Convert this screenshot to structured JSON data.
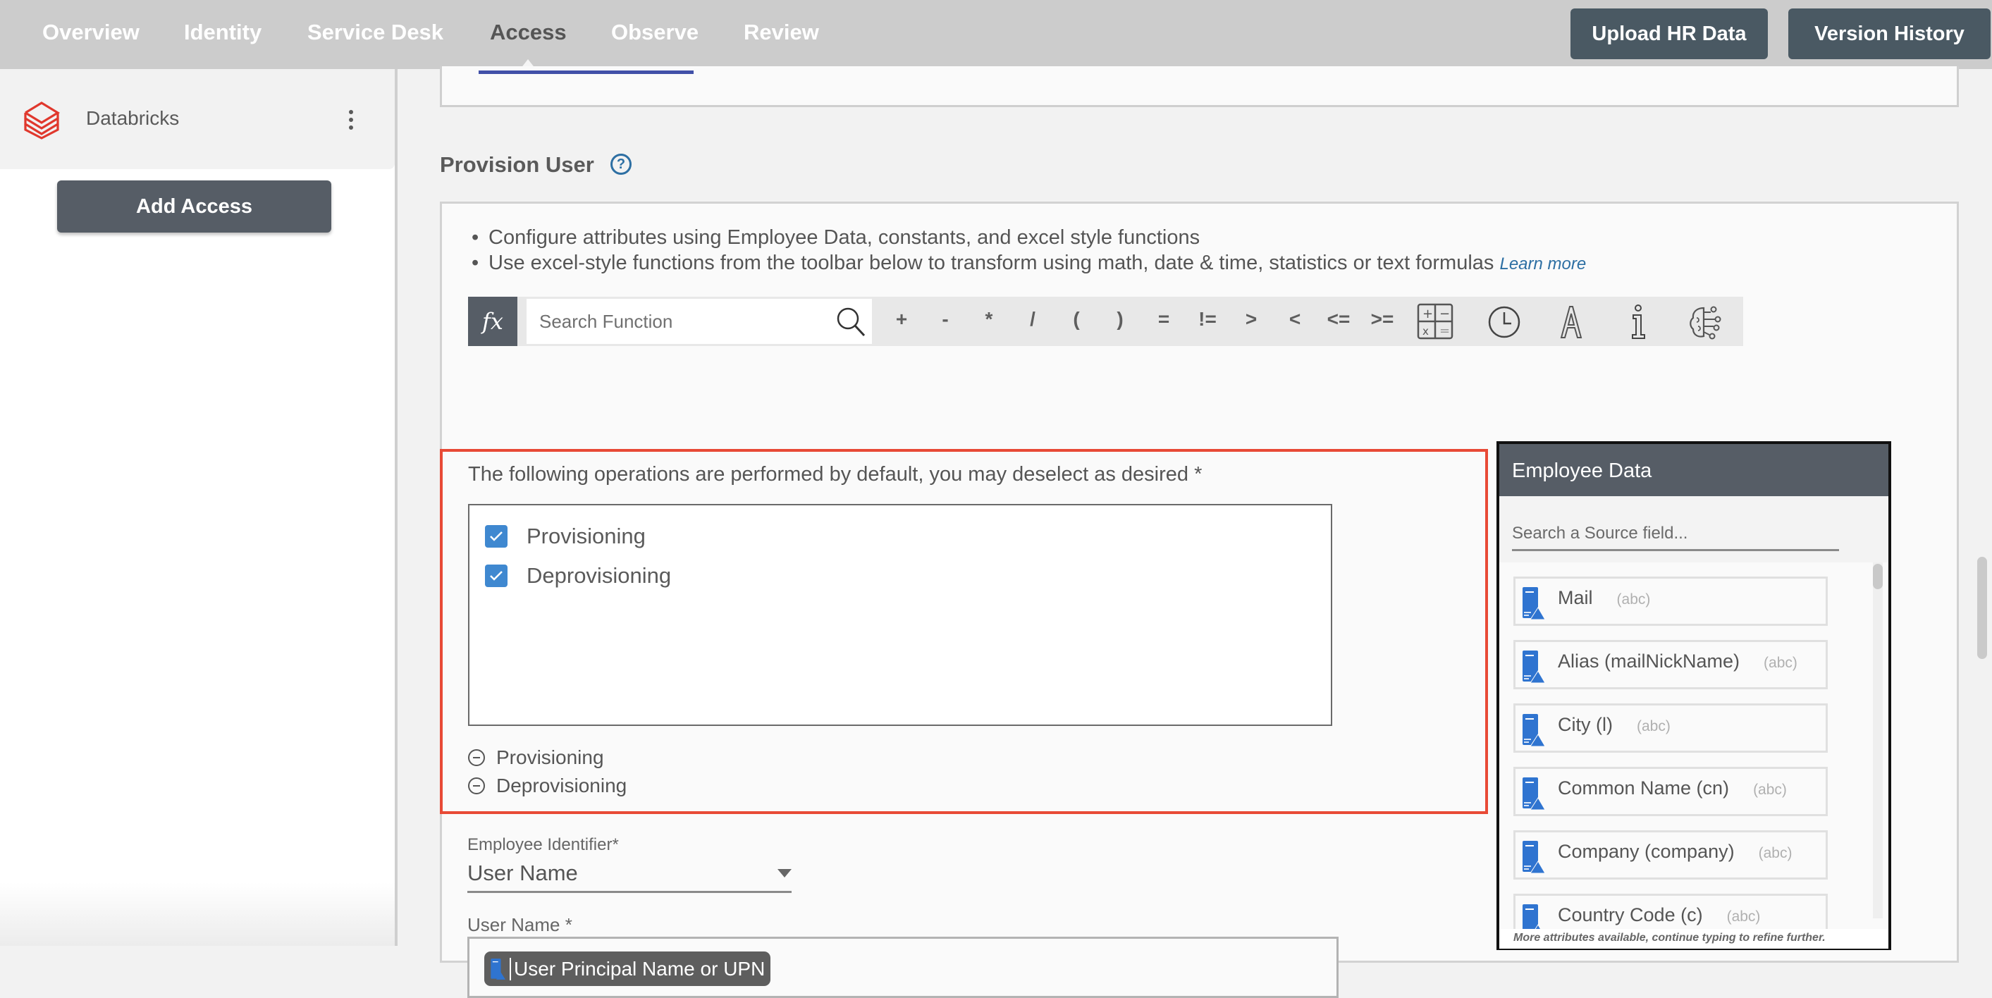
{
  "nav": {
    "items": [
      {
        "label": "Overview",
        "active": false
      },
      {
        "label": "Identity",
        "active": false
      },
      {
        "label": "Service Desk",
        "active": false
      },
      {
        "label": "Access",
        "active": true
      },
      {
        "label": "Observe",
        "active": false
      },
      {
        "label": "Review",
        "active": false
      }
    ],
    "upload_label": "Upload HR Data",
    "version_label": "Version History"
  },
  "sidebar": {
    "app_name": "Databricks",
    "app_icon": "databricks-logo",
    "add_access_label": "Add Access"
  },
  "provision": {
    "title": "Provision User",
    "help_icon": "?",
    "bullets": [
      "Configure attributes using Employee Data, constants, and excel style functions",
      "Use excel-style functions from the toolbar below to transform using math, date & time, statistics or text formulas"
    ],
    "learn_more": "Learn more",
    "toolbar": {
      "fx_label": "fx",
      "search_placeholder": "Search Function",
      "operators": [
        "+",
        "-",
        "*",
        "/",
        "(",
        ")",
        "=",
        "!=",
        ">",
        "<",
        "<=",
        ">="
      ],
      "icons": [
        "calculator-icon",
        "clock-icon",
        "text-icon",
        "info-icon",
        "ai-brain-icon"
      ]
    },
    "operations": {
      "label": "The following operations are performed by default, you may deselect as desired *",
      "checkboxes": [
        {
          "label": "Provisioning",
          "checked": true
        },
        {
          "label": "Deprovisioning",
          "checked": true
        }
      ],
      "summary": [
        "Provisioning",
        "Deprovisioning"
      ]
    },
    "employee_identifier": {
      "label": "Employee Identifier*",
      "value": "User Name"
    },
    "user_name": {
      "label": "User Name *",
      "chip": "User Principal Name or UPN"
    }
  },
  "employee_data": {
    "title": "Employee Data",
    "search_placeholder": "Search a Source field...",
    "items": [
      {
        "name": "Mail",
        "type": "(abc)"
      },
      {
        "name": "Alias (mailNickName)",
        "type": "(abc)"
      },
      {
        "name": "City (l)",
        "type": "(abc)"
      },
      {
        "name": "Common Name (cn)",
        "type": "(abc)"
      },
      {
        "name": "Company (company)",
        "type": "(abc)"
      },
      {
        "name": "Country Code (c)",
        "type": "(abc)"
      }
    ],
    "footer": "More attributes available, continue typing to refine further."
  },
  "colors": {
    "nav_bg": "#cccccc",
    "button_dark": "#4a5963",
    "accent_blue": "#2d6fa3",
    "checkbox_blue": "#3f88d0",
    "highlight_red": "#e84a36",
    "databricks_red": "#e0382d"
  }
}
